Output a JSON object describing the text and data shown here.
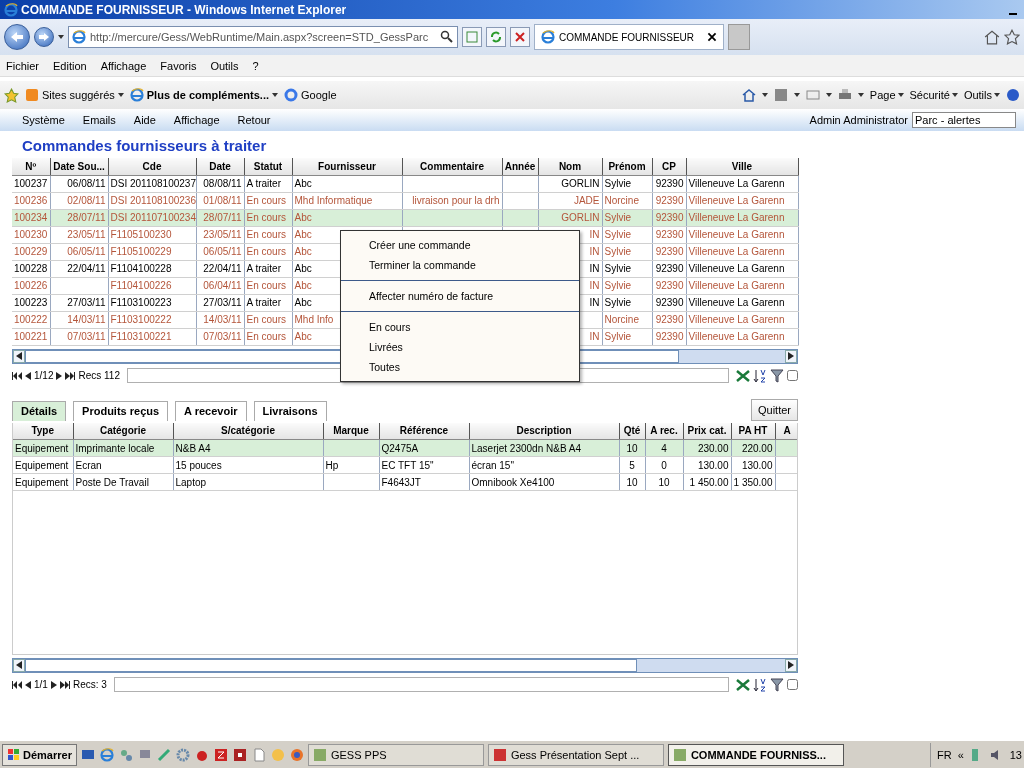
{
  "window": {
    "title": "COMMANDE FOURNISSEUR - Windows Internet Explorer"
  },
  "address_bar": {
    "value": "http://mercure/Gess/WebRuntime/Main.aspx?screen=STD_GessParc"
  },
  "browser_tabs": [
    {
      "label": "COMMANDE FOURNISSEUR",
      "selected": true
    }
  ],
  "menu_bar": [
    "Fichier",
    "Edition",
    "Affichage",
    "Favoris",
    "Outils",
    "?"
  ],
  "favorites_bar": [
    {
      "label": "Sites suggérés",
      "kind": "dropdown"
    },
    {
      "label": "Plus de compléments...",
      "kind": "dropdown"
    },
    {
      "label": "Google",
      "kind": "link"
    }
  ],
  "command_bar": [
    "Page",
    "Sécurité",
    "Outils"
  ],
  "app_menu": [
    "Système",
    "Emails",
    "Aide",
    "Affichage",
    "Retour"
  ],
  "user": "Admin Administrator",
  "view_select": {
    "value": "Parc - alertes"
  },
  "page_title": "Commandes fournisseurs à traiter",
  "orders": {
    "columns": [
      "Nº",
      "Date Sou...",
      "Cde",
      "Date",
      "Statut",
      "Fournisseur",
      "Commentaire",
      "Année",
      "Nom",
      "Prénom",
      "CP",
      "Ville"
    ],
    "rows": [
      {
        "color": "#000000",
        "selected": false,
        "cells": [
          "100237",
          "06/08/11",
          "DSI 201108100237",
          "08/08/11",
          "A traiter",
          "Abc",
          null,
          null,
          "GORLIN",
          "Sylvie",
          "92390",
          "Villeneuve La Garenn"
        ]
      },
      {
        "color": "#b4553a",
        "selected": false,
        "cells": [
          "100236",
          "02/08/11",
          "DSI 201108100236",
          "01/08/11",
          "En cours",
          "Mhd Informatique",
          "livraison pour la drh",
          null,
          "JADE",
          "Norcine",
          "92390",
          "Villeneuve La Garenn"
        ]
      },
      {
        "color": "#b4553a",
        "selected": true,
        "cells": [
          "100234",
          "28/07/11",
          "DSI 201107100234",
          "28/07/11",
          "En cours",
          "Abc",
          null,
          null,
          "GORLIN",
          "Sylvie",
          "92390",
          "Villeneuve La Garenn"
        ]
      },
      {
        "color": "#b4553a",
        "selected": false,
        "cells": [
          "100230",
          "23/05/11",
          "F1105100230",
          "23/05/11",
          "En cours",
          "Abc",
          null,
          null,
          "IN",
          "Sylvie",
          "92390",
          "Villeneuve La Garenn"
        ]
      },
      {
        "color": "#b4553a",
        "selected": false,
        "cells": [
          "100229",
          "06/05/11",
          "F1105100229",
          "06/05/11",
          "En cours",
          "Abc",
          null,
          null,
          "IN",
          "Sylvie",
          "92390",
          "Villeneuve La Garenn"
        ]
      },
      {
        "color": "#000000",
        "selected": false,
        "cells": [
          "100228",
          "22/04/11",
          "F1104100228",
          "22/04/11",
          "A traiter",
          "Abc",
          null,
          null,
          "IN",
          "Sylvie",
          "92390",
          "Villeneuve La Garenn"
        ]
      },
      {
        "color": "#b4553a",
        "selected": false,
        "cells": [
          "100226",
          null,
          "F1104100226",
          "06/04/11",
          "En cours",
          "Abc",
          null,
          null,
          "IN",
          "Sylvie",
          "92390",
          "Villeneuve La Garenn"
        ]
      },
      {
        "color": "#000000",
        "selected": false,
        "cells": [
          "100223",
          "27/03/11",
          "F1103100223",
          "27/03/11",
          "A traiter",
          "Abc",
          null,
          null,
          "IN",
          "Sylvie",
          "92390",
          "Villeneuve La Garenn"
        ]
      },
      {
        "color": "#b4553a",
        "selected": false,
        "cells": [
          "100222",
          "14/03/11",
          "F1103100222",
          "14/03/11",
          "En cours",
          "Mhd Info",
          null,
          null,
          null,
          "Norcine",
          "92390",
          "Villeneuve La Garenn"
        ]
      },
      {
        "color": "#b4553a",
        "selected": false,
        "cells": [
          "100221",
          "07/03/11",
          "F1103100221",
          "07/03/11",
          "En cours",
          "Abc",
          null,
          null,
          "IN",
          "Sylvie",
          "92390",
          "Villeneuve La Garenn"
        ]
      }
    ],
    "pager": {
      "page": "1/12",
      "records": "Recs 112",
      "checked": false
    }
  },
  "context_menu": {
    "items": [
      {
        "kind": "item",
        "label": "Créer une commande"
      },
      {
        "kind": "item",
        "label": "Terminer la commande"
      },
      {
        "kind": "separator"
      },
      {
        "kind": "item",
        "label": "Affecter numéro de facture"
      },
      {
        "kind": "separator"
      },
      {
        "kind": "item",
        "label": "En cours"
      },
      {
        "kind": "item",
        "label": "Livrées"
      },
      {
        "kind": "item",
        "label": "Toutes"
      }
    ]
  },
  "detail_tabs": [
    {
      "label": "Détails",
      "selected": true
    },
    {
      "label": "Produits reçus",
      "selected": false
    },
    {
      "label": "A recevoir",
      "selected": false
    },
    {
      "label": "Livraisons",
      "selected": false
    }
  ],
  "quit_button": "Quitter",
  "lines": {
    "columns": [
      "Type",
      "Catégorie",
      "S/catégorie",
      "Marque",
      "Référence",
      "Description",
      "Qté",
      "A rec.",
      "Prix cat.",
      "PA HT",
      "A"
    ],
    "rows": [
      {
        "selected": true,
        "cells": [
          "Equipement",
          "Imprimante locale",
          "N&B A4",
          null,
          "Q2475A",
          "Laserjet 2300dn N&B A4",
          "10",
          "4",
          "230.00",
          "220.00",
          null
        ]
      },
      {
        "selected": false,
        "cells": [
          "Equipement",
          "Ecran",
          "15 pouces",
          "Hp",
          "EC TFT 15\"",
          "écran 15\"",
          "5",
          "0",
          "130.00",
          "130.00",
          null
        ]
      },
      {
        "selected": false,
        "cells": [
          "Equipement",
          "Poste De Travail",
          "Laptop",
          null,
          "F4643JT",
          "Omnibook Xe4100",
          "10",
          "10",
          "1 450.00",
          "1 350.00",
          null
        ]
      }
    ],
    "pager": {
      "page": "1/1",
      "records": "Recs: 3",
      "checked": false
    }
  },
  "taskbar": {
    "start": "Démarrer",
    "tasks": [
      {
        "label": "GESS PPS",
        "selected": false
      },
      {
        "label": "Gess Présentation Sept ...",
        "selected": false
      },
      {
        "label": "COMMANDE FOURNISS...",
        "selected": true
      }
    ],
    "language": "FR",
    "expand": "«",
    "clock": "13"
  }
}
